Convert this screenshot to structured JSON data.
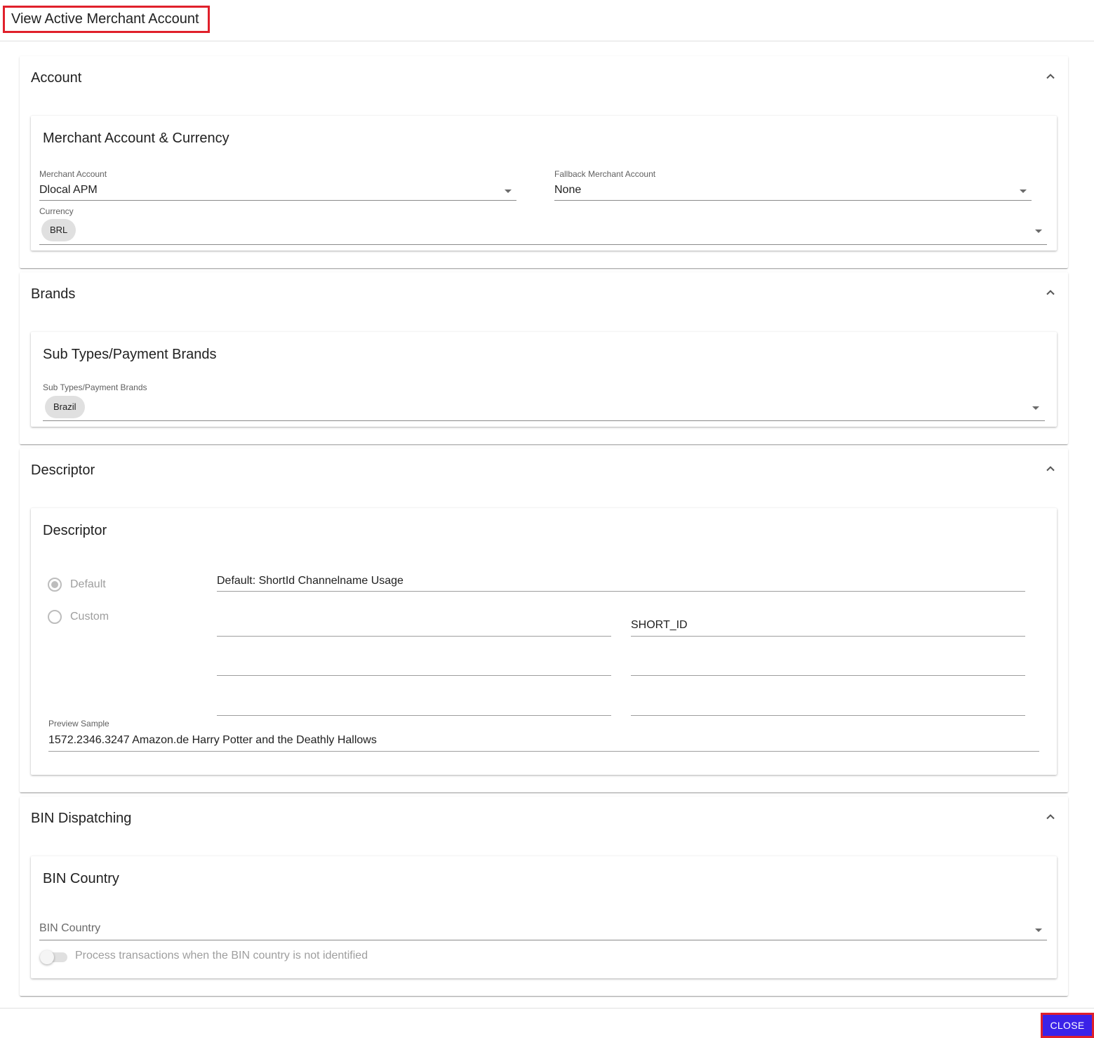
{
  "page_title": "View Active Merchant Account",
  "colors": {
    "primary": "#3b22e8",
    "highlight_border": "#e0202b"
  },
  "icons": {
    "collapse": "chevron-up-icon",
    "dropdown": "caret-down-icon"
  },
  "account": {
    "title": "Account",
    "card_title": "Merchant Account & Currency",
    "merchant_account": {
      "label": "Merchant Account",
      "value": "Dlocal APM"
    },
    "fallback_merchant_account": {
      "label": "Fallback Merchant Account",
      "value": "None"
    },
    "currency": {
      "label": "Currency",
      "chips": [
        "BRL"
      ]
    }
  },
  "brands": {
    "title": "Brands",
    "card_title": "Sub Types/Payment Brands",
    "sub_types": {
      "label": "Sub Types/Payment Brands",
      "chips": [
        "Brazil"
      ]
    }
  },
  "descriptor": {
    "title": "Descriptor",
    "card_title": "Descriptor",
    "options": {
      "default_label": "Default",
      "custom_label": "Custom",
      "selected": "Default"
    },
    "default_value": "Default: ShortId Channelname Usage",
    "custom_fields": [
      "",
      "SHORT_ID",
      "",
      "",
      "",
      ""
    ],
    "preview": {
      "label": "Preview Sample",
      "value": "1572.2346.3247 Amazon.de Harry Potter and the Deathly Hallows"
    }
  },
  "bin_dispatching": {
    "title": "BIN Dispatching",
    "card_title": "BIN Country",
    "bin_country": {
      "placeholder": "BIN Country"
    },
    "toggle": {
      "label": "Process transactions when the BIN country is not identified",
      "checked": false
    }
  },
  "footer": {
    "close_label": "CLOSE"
  }
}
